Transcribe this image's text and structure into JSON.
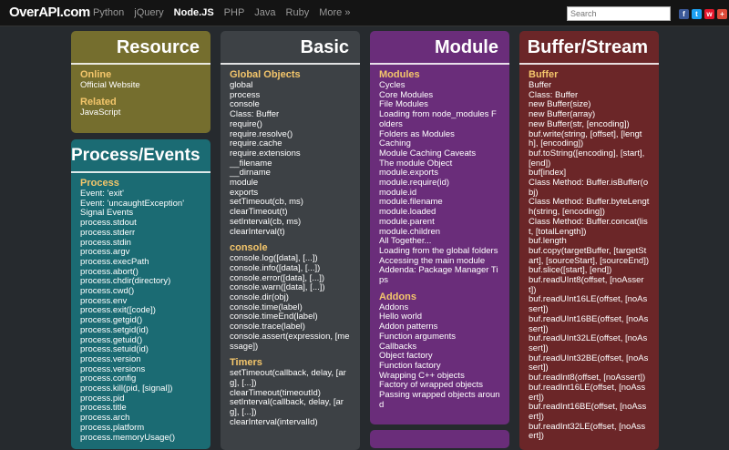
{
  "header": {
    "logo": "OverAPI.com",
    "nav": [
      {
        "label": "Python",
        "active": false
      },
      {
        "label": "jQuery",
        "active": false
      },
      {
        "label": "Node.JS",
        "active": true
      },
      {
        "label": "PHP",
        "active": false
      },
      {
        "label": "Java",
        "active": false
      },
      {
        "label": "Ruby",
        "active": false
      },
      {
        "label": "More »",
        "active": false
      }
    ],
    "search_placeholder": "Search",
    "social": [
      {
        "name": "facebook-icon",
        "glyph": "f",
        "color": "#3b5998"
      },
      {
        "name": "twitter-icon",
        "glyph": "t",
        "color": "#1da1f2"
      },
      {
        "name": "weibo-icon",
        "glyph": "w",
        "color": "#e6162d"
      },
      {
        "name": "google-plus-icon",
        "glyph": "+",
        "color": "#dd4b39"
      }
    ]
  },
  "cards": {
    "resource": {
      "title": "Resource",
      "sections": [
        {
          "name": "Online",
          "items": [
            "Official Website"
          ]
        },
        {
          "name": "Related",
          "items": [
            "JavaScript"
          ]
        }
      ]
    },
    "process": {
      "title": "Process/Events",
      "sections": [
        {
          "name": "Process",
          "items": [
            "Event: 'exit'",
            "Event: 'uncaughtException'",
            "Signal Events",
            "process.stdout",
            "process.stderr",
            "process.stdin",
            "process.argv",
            "process.execPath",
            "process.abort()",
            "process.chdir(directory)",
            "process.cwd()",
            "process.env",
            "process.exit([code])",
            "process.getgid()",
            "process.setgid(id)",
            "process.getuid()",
            "process.setuid(id)",
            "process.version",
            "process.versions",
            "process.config",
            "process.kill(pid, [signal])",
            "process.pid",
            "process.title",
            "process.arch",
            "process.platform",
            "process.memoryUsage()"
          ]
        }
      ]
    },
    "basic": {
      "title": "Basic",
      "sections": [
        {
          "name": "Global Objects",
          "items": [
            "global",
            "process",
            "console",
            "Class: Buffer",
            "require()",
            "require.resolve()",
            "require.cache",
            "require.extensions",
            "__filename",
            "__dirname",
            "module",
            "exports",
            "setTimeout(cb, ms)",
            "clearTimeout(t)",
            "setInterval(cb, ms)",
            "clearInterval(t)"
          ]
        },
        {
          "name": "console",
          "items": [
            "console.log([data], [...])",
            "console.info([data], [...])",
            "console.error([data], [...])",
            "console.warn([data], [...])",
            "console.dir(obj)",
            "console.time(label)",
            "console.timeEnd(label)",
            "console.trace(label)",
            "console.assert(expression, [message])"
          ]
        },
        {
          "name": "Timers",
          "items": [
            "setTimeout(callback, delay, [arg], [...])",
            "clearTimeout(timeoutId)",
            "setInterval(callback, delay, [arg], [...])",
            "clearInterval(intervalId)"
          ]
        }
      ]
    },
    "module": {
      "title": "Module",
      "sections": [
        {
          "name": "Modules",
          "items": [
            "Cycles",
            "Core Modules",
            "File Modules",
            "Loading from node_modules Folders",
            "Folders as Modules",
            "Caching",
            "Module Caching Caveats",
            "The module Object",
            "module.exports",
            "module.require(id)",
            "module.id",
            "module.filename",
            "module.loaded",
            "module.parent",
            "module.children",
            "All Together...",
            "Loading from the global folders",
            "Accessing the main module",
            "Addenda: Package Manager Tips"
          ]
        },
        {
          "name": "Addons",
          "items": [
            "Addons",
            "Hello world",
            "Addon patterns",
            "Function arguments",
            "Callbacks",
            "Object factory",
            "Function factory",
            "Wrapping C++ objects",
            "Factory of wrapped objects",
            "Passing wrapped objects around"
          ]
        }
      ]
    },
    "buffer": {
      "title": "Buffer/Stream",
      "sections": [
        {
          "name": "Buffer",
          "items": [
            "Buffer",
            "Class: Buffer",
            "new Buffer(size)",
            "new Buffer(array)",
            "new Buffer(str, [encoding])",
            "buf.write(string, [offset], [length], [encoding])",
            "buf.toString([encoding], [start], [end])",
            "buf[index]",
            "Class Method: Buffer.isBuffer(obj)",
            "Class Method: Buffer.byteLength(string, [encoding])",
            "Class Method: Buffer.concat(list, [totalLength])",
            "buf.length",
            "buf.copy(targetBuffer, [targetStart], [sourceStart], [sourceEnd])",
            "buf.slice([start], [end])",
            "buf.readUInt8(offset, [noAssert])",
            "buf.readUInt16LE(offset, [noAssert])",
            "buf.readUInt16BE(offset, [noAssert])",
            "buf.readUInt32LE(offset, [noAssert])",
            "buf.readUInt32BE(offset, [noAssert])",
            "buf.readInt8(offset, [noAssert])",
            "buf.readInt16LE(offset, [noAssert])",
            "buf.readInt16BE(offset, [noAssert])",
            "buf.readInt32LE(offset, [noAssert])"
          ]
        }
      ]
    }
  }
}
